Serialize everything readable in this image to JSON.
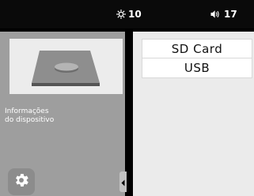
{
  "status_bar": {
    "brightness_icon": "sun-icon",
    "brightness_value": "10",
    "volume_icon": "speaker-icon",
    "volume_value": "17"
  },
  "left_panel": {
    "device_image": "printer-plate-illustration",
    "device_info_line1": "Informações",
    "device_info_line2": "do dispositivo",
    "settings_icon": "gear-icon",
    "collapse_icon": "chevron-left-icon"
  },
  "right_panel": {
    "items": [
      {
        "label": "SD Card"
      },
      {
        "label": "USB"
      }
    ]
  },
  "colors": {
    "background": "#000000",
    "left_panel": "#9e9e9e",
    "right_panel": "#ebebeb",
    "text_light": "#ffffff",
    "text_dark": "#111111"
  }
}
